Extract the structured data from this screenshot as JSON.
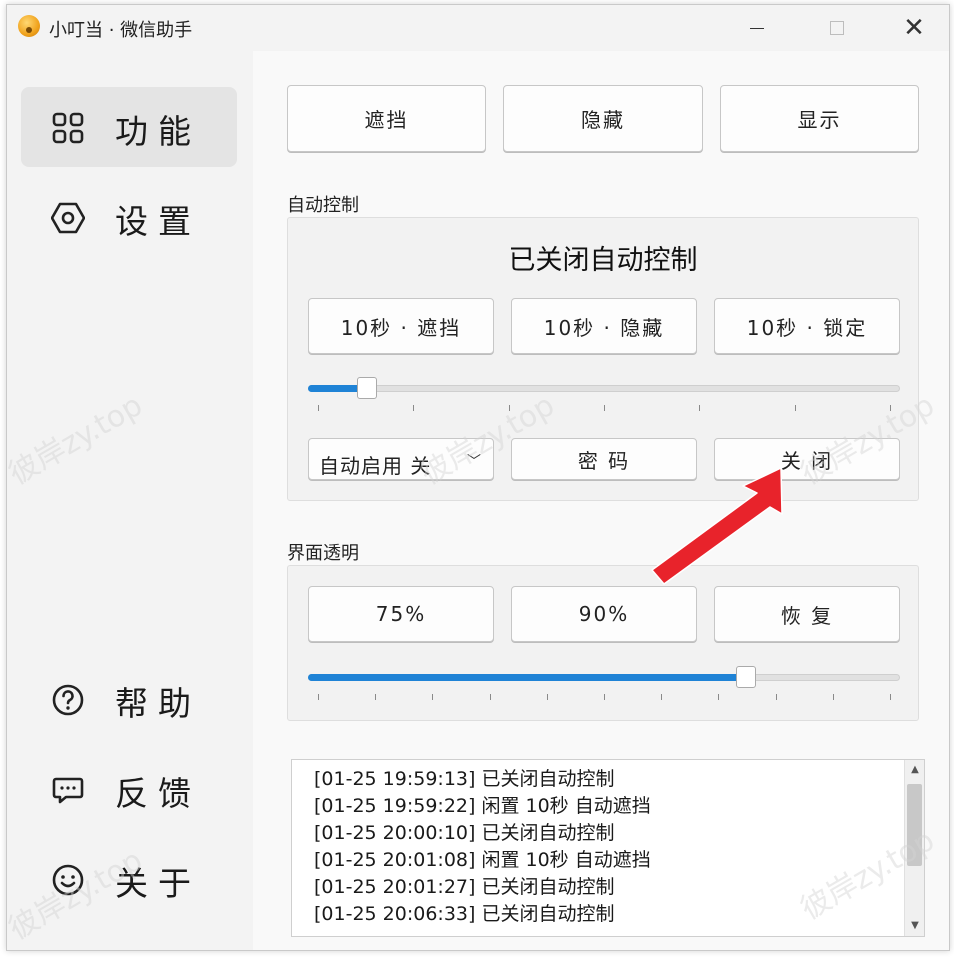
{
  "window": {
    "title": "小叮当 · 微信助手"
  },
  "sidebar": {
    "items": [
      {
        "label": "功能",
        "icon": "grid-icon",
        "active": true
      },
      {
        "label": "设置",
        "icon": "hexagon-settings-icon",
        "active": false
      },
      {
        "label": "帮助",
        "icon": "question-icon",
        "active": false
      },
      {
        "label": "反馈",
        "icon": "feedback-chat-icon",
        "active": false
      },
      {
        "label": "关于",
        "icon": "smile-icon",
        "active": false
      }
    ]
  },
  "actions": {
    "block": "遮挡",
    "hide": "隐藏",
    "show": "显示"
  },
  "auto_control": {
    "label": "自动控制",
    "status": "已关闭自动控制",
    "buttons": {
      "block": "10秒 · 遮挡",
      "hide": "10秒 · 隐藏",
      "lock": "10秒 · 锁定"
    },
    "slider_level": 0.1,
    "select_value": "自动启用 关",
    "password_label": "密 码",
    "close_label": "关 闭"
  },
  "transparency": {
    "label": "界面透明",
    "buttons": {
      "p75": "75%",
      "p90": "90%",
      "restore": "恢 复"
    },
    "slider_level": 0.74
  },
  "log": [
    {
      "time": "[01-25 19:59:13]",
      "text": "已关闭自动控制"
    },
    {
      "time": "[01-25 19:59:22]",
      "text": "闲置 10秒 自动遮挡"
    },
    {
      "time": "[01-25 20:00:10]",
      "text": "已关闭自动控制"
    },
    {
      "time": "[01-25 20:01:08]",
      "text": "闲置 10秒 自动遮挡"
    },
    {
      "time": "[01-25 20:01:27]",
      "text": "已关闭自动控制"
    },
    {
      "time": "[01-25 20:06:33]",
      "text": "已关闭自动控制"
    }
  ],
  "watermark": "彼岸zy.top",
  "colors": {
    "accent": "#1f83d6",
    "arrow": "#e8232b"
  }
}
